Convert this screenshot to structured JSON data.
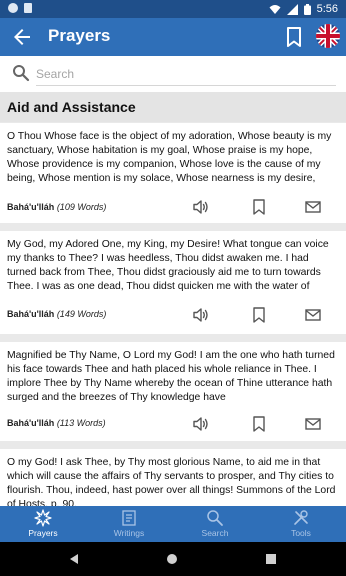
{
  "statusbar": {
    "time": "5:56"
  },
  "appbar": {
    "title": "Prayers"
  },
  "search": {
    "placeholder": "Search"
  },
  "section": {
    "title": "Aid and Assistance"
  },
  "prayers": [
    {
      "text": "O Thou Whose face is the object of my adoration, Whose beauty is my sanctuary, Whose habitation is my goal, Whose praise is my hope, Whose providence is my companion, Whose love is the cause of my being, Whose mention is my solace, Whose nearness is my desire,",
      "author": "Bahá'u'lláh",
      "words": "(109 Words)"
    },
    {
      "text": "My God, my Adored One, my King, my Desire! What tongue can voice my thanks to Thee? I was heedless, Thou didst awaken me. I had turned back from Thee, Thou didst graciously aid me to turn towards Thee. I was as one dead, Thou didst quicken me with the water of",
      "author": "Bahá'u'lláh",
      "words": "(149 Words)"
    },
    {
      "text": "Magnified be Thy Name, O Lord my God! I am the one who hath turned his face towards Thee and hath placed his whole reliance in Thee. I implore Thee by Thy Name whereby the ocean of Thine utterance hath surged and the breezes of Thy knowledge have",
      "author": "Bahá'u'lláh",
      "words": "(113 Words)"
    },
    {
      "text": "O my God! I ask Thee, by Thy most glorious Name, to aid me in that which will cause the affairs of Thy servants to prosper, and Thy cities to flourish. Thou, indeed, hast power over all things! Summons of the Lord of Hosts, p. 90.",
      "author": "",
      "words": ""
    }
  ],
  "nav": [
    {
      "label": "Prayers",
      "icon": "prayers-star-icon",
      "active": true
    },
    {
      "label": "Writings",
      "icon": "book-icon",
      "active": false
    },
    {
      "label": "Search",
      "icon": "search-icon",
      "active": false
    },
    {
      "label": "Tools",
      "icon": "tools-icon",
      "active": false
    }
  ],
  "colors": {
    "primary": "#2f6fb8",
    "statusbar": "#1f4f8a",
    "background": "#e9e9e9",
    "inactive_nav": "#a9c4e6"
  }
}
